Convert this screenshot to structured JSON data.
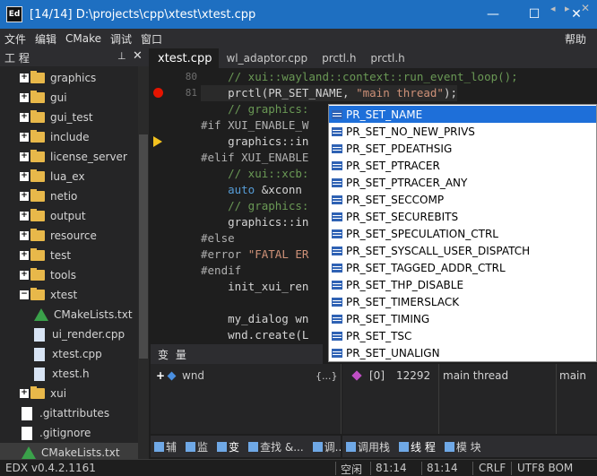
{
  "window": {
    "icon_text": "Ed",
    "title": "[14/14] D:\\projects\\cpp\\xtest\\xtest.cpp",
    "minimize": "—",
    "maximize": "☐",
    "close": "✕"
  },
  "menu": {
    "items": [
      "文件",
      "编辑",
      "CMake",
      "调试",
      "窗口"
    ],
    "help": "帮助"
  },
  "project": {
    "title": "工 程",
    "pin": "📌",
    "close": "✕",
    "tree": [
      {
        "label": "graphics",
        "type": "folder",
        "expander": "+"
      },
      {
        "label": "gui",
        "type": "folder",
        "expander": "+"
      },
      {
        "label": "gui_test",
        "type": "folder",
        "expander": "+"
      },
      {
        "label": "include",
        "type": "folder",
        "expander": "+"
      },
      {
        "label": "license_server",
        "type": "folder",
        "expander": "+"
      },
      {
        "label": "lua_ex",
        "type": "folder",
        "expander": "+"
      },
      {
        "label": "netio",
        "type": "folder",
        "expander": "+"
      },
      {
        "label": "output",
        "type": "folder",
        "expander": "+"
      },
      {
        "label": "resource",
        "type": "folder",
        "expander": "+"
      },
      {
        "label": "test",
        "type": "folder",
        "expander": "+"
      },
      {
        "label": "tools",
        "type": "folder",
        "expander": "+"
      },
      {
        "label": "xtest",
        "type": "folder",
        "expander": "−"
      },
      {
        "label": "CMakeLists.txt",
        "type": "cmake"
      },
      {
        "label": "ui_render.cpp",
        "type": "cpp"
      },
      {
        "label": "xtest.cpp",
        "type": "cpp"
      },
      {
        "label": "xtest.h",
        "type": "h"
      },
      {
        "label": "xui",
        "type": "folder",
        "expander": "+"
      },
      {
        "label": ".gitattributes",
        "type": "file"
      },
      {
        "label": ".gitignore",
        "type": "file"
      },
      {
        "label": "CMakeLists.txt",
        "type": "cmake",
        "selected": true
      }
    ]
  },
  "tabs": {
    "items": [
      "xtest.cpp",
      "wl_adaptor.cpp",
      "prctl.h",
      "prctl.h"
    ],
    "active": 0,
    "prev": "◂",
    "next": "▸",
    "close": "✕"
  },
  "editor": {
    "lines": [
      {
        "num": "80",
        "segments": [
          {
            "t": "    // xui::wayland::context::run_event_loop();",
            "c": "comment"
          }
        ]
      },
      {
        "num": "81",
        "bp": true,
        "hl": true,
        "segments": [
          {
            "t": "    prctl(PR_SET_NAME, ",
            "c": ""
          },
          {
            "t": "\"main thread\"",
            "c": "str"
          },
          {
            "t": ");",
            "c": ""
          }
        ]
      },
      {
        "num": "",
        "segments": [
          {
            "t": "    // graphics:",
            "c": "comment"
          }
        ]
      },
      {
        "num": "",
        "segments": [
          {
            "t": "#if XUI_ENABLE_W",
            "c": "pp"
          }
        ]
      },
      {
        "num": "",
        "arrow": true,
        "segments": [
          {
            "t": "    graphics::in",
            "c": ""
          }
        ]
      },
      {
        "num": "",
        "segments": [
          {
            "t": "#elif XUI_ENABLE",
            "c": "pp"
          }
        ]
      },
      {
        "num": "",
        "segments": [
          {
            "t": "    // xui::xcb:",
            "c": "comment"
          }
        ]
      },
      {
        "num": "",
        "segments": [
          {
            "t": "    auto",
            "c": "kw"
          },
          {
            "t": " &xconn",
            "c": ""
          }
        ]
      },
      {
        "num": "",
        "segments": [
          {
            "t": "    // graphics:",
            "c": "comment"
          }
        ]
      },
      {
        "num": "",
        "segments": [
          {
            "t": "    graphics::in",
            "c": ""
          }
        ]
      },
      {
        "num": "",
        "segments": [
          {
            "t": "#else",
            "c": "pp"
          }
        ]
      },
      {
        "num": "",
        "segments": [
          {
            "t": "#error ",
            "c": "pp"
          },
          {
            "t": "\"FATAL ER",
            "c": "str"
          }
        ]
      },
      {
        "num": "",
        "segments": [
          {
            "t": "#endif",
            "c": "pp"
          }
        ]
      },
      {
        "num": "",
        "segments": [
          {
            "t": "    init_xui_ren",
            "c": ""
          }
        ]
      },
      {
        "num": "",
        "segments": [
          {
            "t": "",
            "c": ""
          }
        ]
      },
      {
        "num": "",
        "segments": [
          {
            "t": "    my_dialog wn",
            "c": ""
          }
        ]
      },
      {
        "num": "",
        "segments": [
          {
            "t": "    wnd.create(L",
            "c": ""
          }
        ]
      }
    ]
  },
  "completion": {
    "items": [
      "PR_SET_NAME",
      "PR_SET_NO_NEW_PRIVS",
      "PR_SET_PDEATHSIG",
      "PR_SET_PTRACER",
      "PR_SET_PTRACER_ANY",
      "PR_SET_SECCOMP",
      "PR_SET_SECUREBITS",
      "PR_SET_SPECULATION_CTRL",
      "PR_SET_SYSCALL_USER_DISPATCH",
      "PR_SET_TAGGED_ADDR_CTRL",
      "PR_SET_THP_DISABLE",
      "PR_SET_TIMERSLACK",
      "PR_SET_TIMING",
      "PR_SET_TSC",
      "PR_SET_UNALIGN"
    ],
    "selected": 0
  },
  "variables": {
    "title": "变 量",
    "row": {
      "expander": "+",
      "name": "wnd",
      "value": "{...}"
    }
  },
  "callstack": {
    "row": {
      "index": "[0]",
      "thread_id": "12292",
      "name": "main thread",
      "func": "main"
    }
  },
  "bottom_tabs_left": [
    "辅",
    "监",
    "变"
  ],
  "bottom_tabs_mid": [
    "查找 &...",
    "调..."
  ],
  "bottom_tabs_right": [
    "调用栈",
    "线 程",
    "模 块"
  ],
  "status": {
    "version": "EDX v0.4.2.1161",
    "state": "空闲",
    "pos1": "81:14",
    "pos2": "81:14",
    "eol": "CRLF",
    "encoding": "UTF8 BOM"
  }
}
